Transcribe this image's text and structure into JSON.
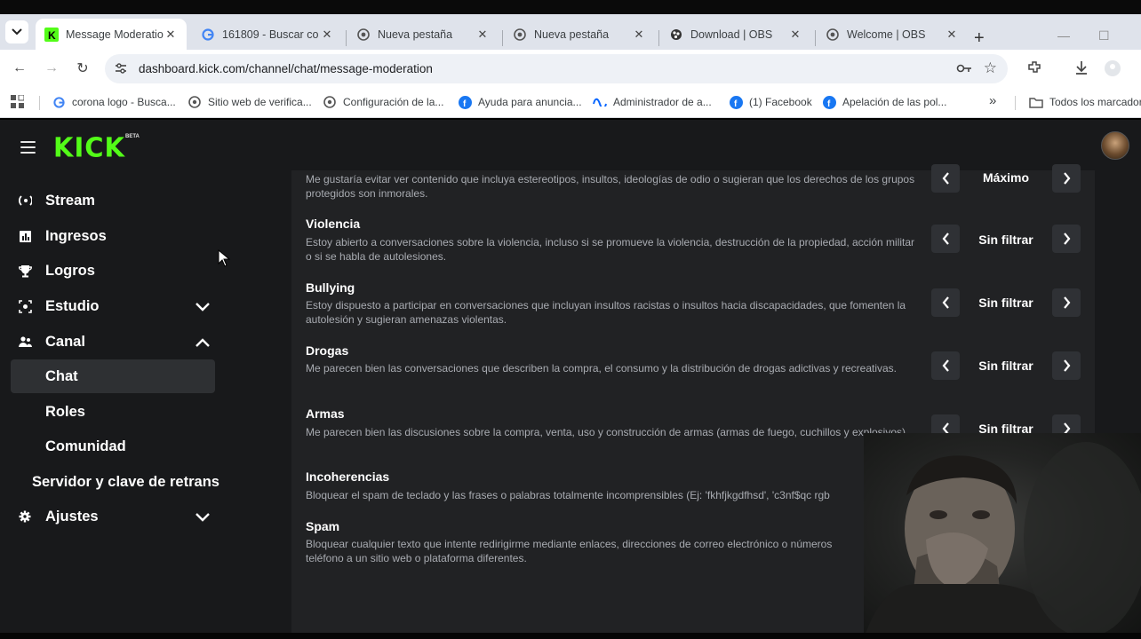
{
  "browser": {
    "tabs": [
      {
        "title": "Message Moderatio",
        "favicon": "kick-icon",
        "active": true
      },
      {
        "title": "161809 - Buscar co",
        "favicon": "google-icon",
        "active": false
      },
      {
        "title": "Nueva pestaña",
        "favicon": "chrome-icon",
        "active": false
      },
      {
        "title": "Nueva pestaña",
        "favicon": "chrome-icon",
        "active": false
      },
      {
        "title": "Download | OBS",
        "favicon": "obs-icon",
        "active": false
      },
      {
        "title": "Welcome | OBS",
        "favicon": "obs-icon",
        "active": false
      }
    ],
    "new_tab_symbol": "+",
    "url": "dashboard.kick.com/channel/chat/message-moderation",
    "bookmarks": [
      {
        "label": "corona logo - Busca...",
        "icon": "google-icon"
      },
      {
        "label": "Sitio web de verifica...",
        "icon": "globe-icon"
      },
      {
        "label": "Configuración de la...",
        "icon": "globe-icon"
      },
      {
        "label": "Ayuda para anuncia...",
        "icon": "facebook-icon"
      },
      {
        "label": "Administrador de a...",
        "icon": "meta-icon"
      },
      {
        "label": "(1) Facebook",
        "icon": "facebook-icon"
      },
      {
        "label": "Apelación de las pol...",
        "icon": "facebook-icon"
      }
    ],
    "bookmarks_more": "»",
    "all_bookmarks": "Todos los marcador"
  },
  "app": {
    "logo": "KICK",
    "beta": "BETA",
    "accent": "#53fc18"
  },
  "sidebar": {
    "items": [
      {
        "label": "Stream",
        "icon": "broadcast-icon"
      },
      {
        "label": "Ingresos",
        "icon": "chart-icon"
      },
      {
        "label": "Logros",
        "icon": "trophy-icon"
      },
      {
        "label": "Estudio",
        "icon": "studio-icon",
        "chevron": "down"
      },
      {
        "label": "Canal",
        "icon": "users-icon",
        "chevron": "up"
      },
      {
        "label": "Chat",
        "selected": true
      },
      {
        "label": "Roles"
      },
      {
        "label": "Comunidad"
      },
      {
        "label": "Servidor y clave de retrans"
      },
      {
        "label": "Ajustes",
        "icon": "gear-icon",
        "chevron": "down"
      }
    ]
  },
  "moderation": {
    "rows": [
      {
        "title": "",
        "desc": "Me gustaría evitar ver contenido que incluya estereotipos, insultos, ideologías de odio o sugieran que los derechos de los grupos protegidos son inmorales.",
        "value": "Máximo"
      },
      {
        "title": "Violencia",
        "desc": "Estoy abierto a conversaciones sobre la violencia, incluso si se promueve la violencia, destrucción de la propiedad, acción militar o si se habla de autolesiones.",
        "value": "Sin filtrar"
      },
      {
        "title": "Bullying",
        "desc": "Estoy dispuesto a participar en conversaciones que incluyan insultos racistas o insultos hacia discapacidades, que fomenten la autolesión y sugieran amenazas violentas.",
        "value": "Sin filtrar"
      },
      {
        "title": "Drogas",
        "desc": "Me parecen bien las conversaciones que describen la compra, el consumo y la distribución de drogas adictivas y recreativas.",
        "value": "Sin filtrar"
      },
      {
        "title": "Armas",
        "desc": "Me parecen bien las discusiones sobre la compra, venta, uso y construcción de armas (armas de fuego, cuchillos y explosivos).",
        "value": "Sin filtrar"
      },
      {
        "title": "Incoherencias",
        "desc": "Bloquear el spam de teclado y las frases o palabras totalmente incomprensibles (Ej: 'fkhfjkgdfhsd', 'c3nf$qc rgb"
      },
      {
        "title": "Spam",
        "desc": "Bloquear cualquier texto que intente redirigirme mediante enlaces, direcciones de correo electrónico o números teléfono a un sitio web o plataforma diferentes."
      }
    ]
  }
}
